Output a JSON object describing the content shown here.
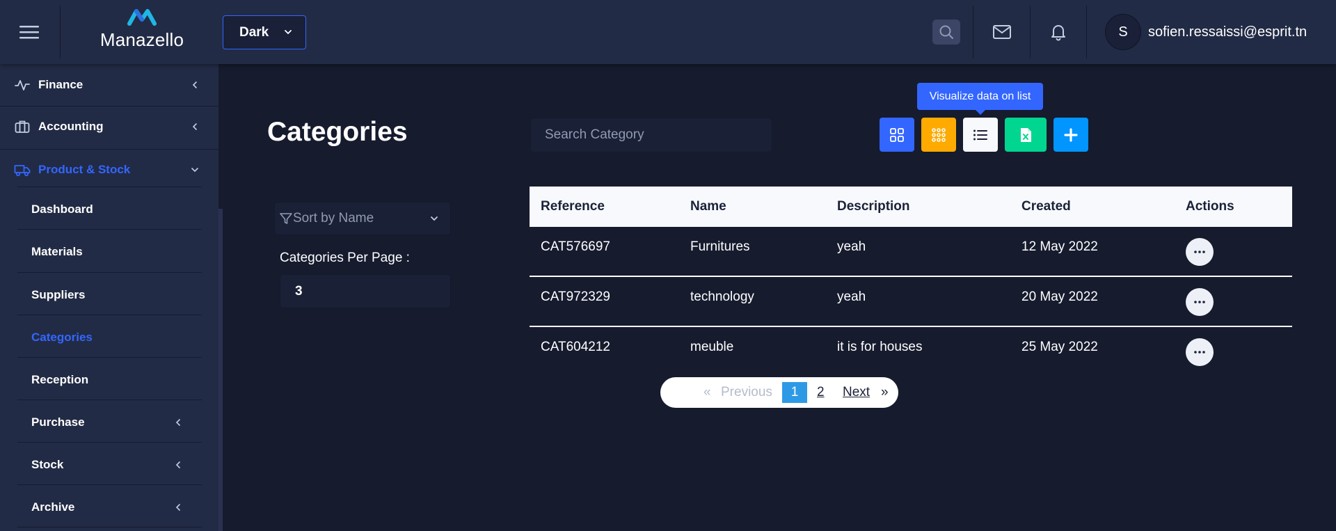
{
  "header": {
    "logo_text": "Manazello",
    "theme_value": "Dark",
    "user_initial": "S",
    "user_email": "sofien.ressaissi@esprit.tn"
  },
  "sidebar": {
    "items": [
      {
        "label": "Finance",
        "icon": "activity-icon"
      },
      {
        "label": "Accounting",
        "icon": "briefcase-icon"
      },
      {
        "label": "Product & Stock",
        "icon": "car-icon",
        "active": true
      }
    ],
    "sub_items": [
      {
        "label": "Dashboard"
      },
      {
        "label": "Materials"
      },
      {
        "label": "Suppliers"
      },
      {
        "label": "Categories",
        "active": true
      },
      {
        "label": "Reception"
      },
      {
        "label": "Purchase"
      },
      {
        "label": "Stock"
      },
      {
        "label": "Archive"
      }
    ]
  },
  "main": {
    "title": "Categories",
    "search_placeholder": "Search Category",
    "tooltip": "Visualize data on list",
    "sort_value": "Sort by Name",
    "per_page_label": "Categories Per Page :",
    "per_page_value": "3",
    "toolbar_colors": {
      "grid": "#3366ff",
      "apps": "#ffaa00",
      "list": "#f7f9fc",
      "excel": "#00d68f",
      "add": "#0095ff"
    }
  },
  "table": {
    "columns": [
      "Reference",
      "Name",
      "Description",
      "Created",
      "Actions"
    ],
    "rows": [
      [
        "CAT576697",
        "Furnitures",
        "yeah",
        "12 May 2022"
      ],
      [
        "CAT972329",
        "technology",
        "yeah",
        "20 May 2022"
      ],
      [
        "CAT604212",
        "meuble",
        "it is for houses",
        "25 May 2022"
      ]
    ]
  },
  "pagination": {
    "prev_arrow": "«",
    "previous": "Previous",
    "pages": [
      "1",
      "2"
    ],
    "current": "1",
    "next": "Next",
    "next_arrow": "»"
  }
}
